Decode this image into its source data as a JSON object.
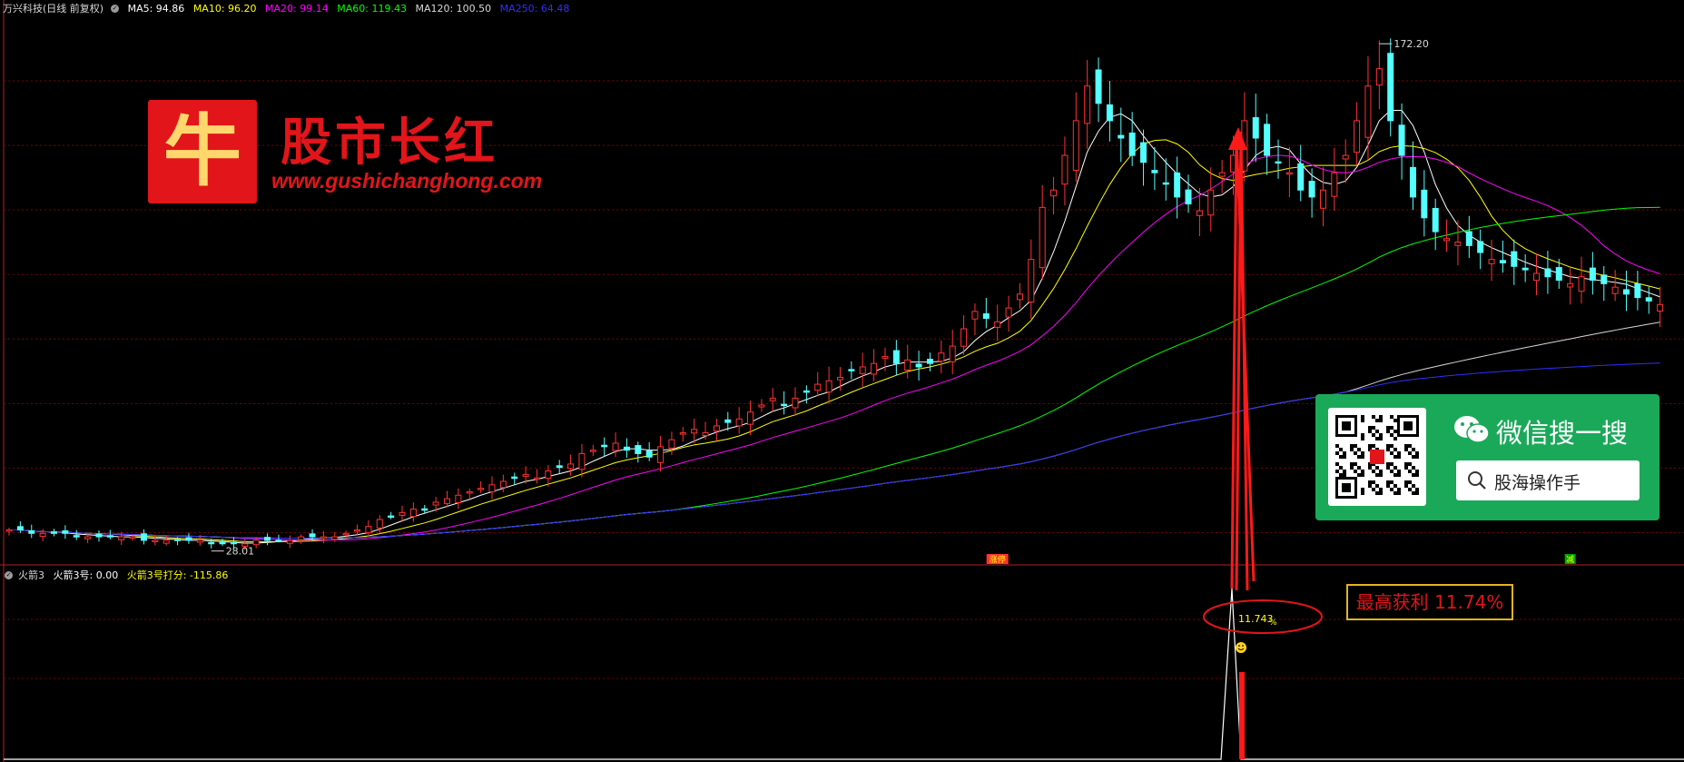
{
  "main_panel": {
    "title": "万兴科技(日线 前复权)",
    "ma_legend": [
      {
        "label": "MA5: 94.86",
        "color": "#ffffff"
      },
      {
        "label": "MA10: 96.20",
        "color": "#ffff00"
      },
      {
        "label": "MA20: 99.14",
        "color": "#ff00ff"
      },
      {
        "label": "MA60: 119.43",
        "color": "#00ff00"
      },
      {
        "label": "MA120: 100.50",
        "color": "#d8d8d8"
      },
      {
        "label": "MA250: 64.48",
        "color": "#0000ff"
      }
    ],
    "high_label": "172.20",
    "low_label": "28.01",
    "marker_1": "涨停",
    "marker_2": "减"
  },
  "sub_panel": {
    "title": "火箭3",
    "indicator_1": "火箭3号: 0.00",
    "indicator_2": "火箭3号打分: -115.86",
    "peak_label": "11.743",
    "peak_unit": "%"
  },
  "overlay": {
    "logo_char": "牛",
    "logo_title": "股市长红",
    "logo_url": "www.gushichanghong.com",
    "wechat_title": "微信搜一搜",
    "wechat_search": "股海操作手",
    "profit_label": "最高获利 11.74%"
  },
  "colors": {
    "up_candle": "#ff3232",
    "down_candle": "#54ffff",
    "grid": "#7a0000",
    "axis": "#b22222",
    "arrow": "#ff1a1a",
    "annotation_ellipse": "#e1151a",
    "profit_border": "#e6b21f"
  },
  "chart_data": {
    "type": "candlestick",
    "title": "万兴科技(日线 前复权)",
    "period": "daily",
    "adjustment": "前复权",
    "ylim": [
      24,
      178
    ],
    "highest_price": 172.2,
    "lowest_price": 28.01,
    "candles_approx_close": [
      32,
      32,
      31,
      31,
      31,
      31,
      30,
      30,
      30,
      30,
      30,
      30,
      29,
      29,
      29,
      29,
      29,
      29,
      28,
      28,
      28,
      28,
      29,
      29,
      29,
      29,
      30,
      30,
      30,
      30,
      31,
      32,
      33,
      35,
      36,
      37,
      38,
      38,
      40,
      41,
      42,
      43,
      44,
      45,
      46,
      47,
      48,
      47,
      49,
      50,
      51,
      54,
      55,
      56,
      57,
      55,
      54,
      53,
      56,
      58,
      60,
      61,
      60,
      62,
      63,
      64,
      66,
      68,
      70,
      68,
      70,
      72,
      74,
      75,
      76,
      78,
      79,
      80,
      82,
      80,
      81,
      79,
      80,
      83,
      85,
      90,
      95,
      93,
      92,
      96,
      100,
      110,
      125,
      130,
      140,
      150,
      160,
      155,
      150,
      145,
      140,
      138,
      135,
      132,
      128,
      126,
      124,
      130,
      135,
      140,
      150,
      145,
      140,
      138,
      135,
      130,
      128,
      130,
      135,
      140,
      150,
      160,
      165,
      150,
      140,
      128,
      122,
      118,
      116,
      115,
      114,
      112,
      110,
      109,
      108,
      107,
      106,
      105,
      104,
      103,
      105,
      104,
      103,
      102,
      100,
      99,
      98,
      97
    ]
  }
}
